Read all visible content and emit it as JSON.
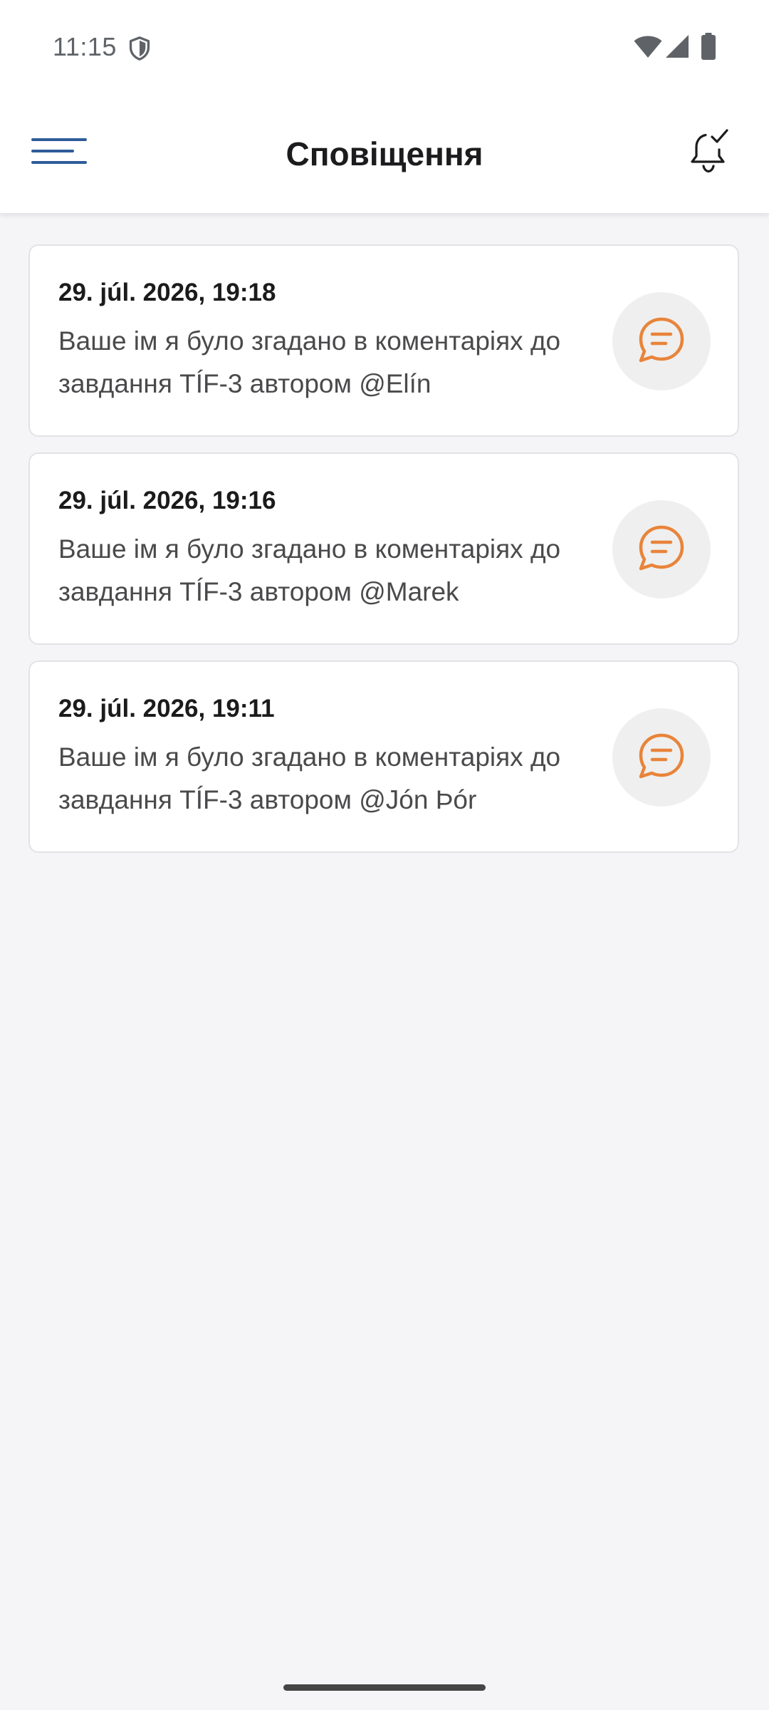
{
  "status_bar": {
    "time": "11:15",
    "icons": [
      "shield-icon",
      "wifi-icon",
      "cellular-signal-icon",
      "battery-icon"
    ]
  },
  "app_bar": {
    "title": "Сповіщення",
    "menu_icon": "hamburger-menu-icon",
    "action_icon": "bell-check-icon"
  },
  "notifications": [
    {
      "date": "29. júl. 2026, 19:18",
      "message": "Ваше ім я було згадано в коментаріях до завдання TÍF-3 автором @Elín",
      "icon": "comment-icon"
    },
    {
      "date": "29. júl. 2026, 19:16",
      "message": "Ваше ім я було згадано в коментаріях до завдання TÍF-3 автором @Marek",
      "icon": "comment-icon"
    },
    {
      "date": "29. júl. 2026, 19:11",
      "message": "Ваше ім я було згадано в коментаріях до завдання TÍF-3 автором @Jón Þór",
      "icon": "comment-icon"
    }
  ],
  "colors": {
    "accent": "#2f5c99",
    "comment_icon": "#e8843a",
    "background": "#f5f5f7",
    "card": "#ffffff"
  }
}
